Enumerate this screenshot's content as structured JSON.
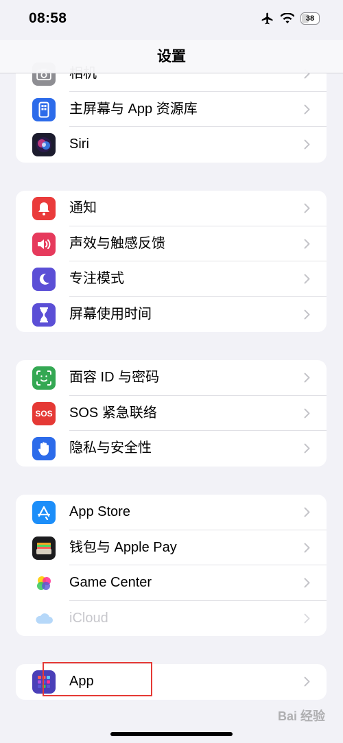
{
  "status_bar": {
    "time": "08:58",
    "battery": "38",
    "battery_fraction": 0.38
  },
  "nav": {
    "title": "设置"
  },
  "groups": [
    {
      "items": [
        {
          "label": "相机",
          "icon": "camera-icon",
          "color": "#8e8e93"
        },
        {
          "label": "主屏幕与 App 资源库",
          "icon": "home-screen-icon",
          "color": "#2c6bea"
        },
        {
          "label": "Siri",
          "icon": "siri-icon",
          "color": "#1c1c2e"
        }
      ]
    },
    {
      "items": [
        {
          "label": "通知",
          "icon": "bell-icon",
          "color": "#ea3b3b"
        },
        {
          "label": "声效与触感反馈",
          "icon": "speaker-icon",
          "color": "#e63a5c"
        },
        {
          "label": "专注模式",
          "icon": "moon-icon",
          "color": "#5b4fd6"
        },
        {
          "label": "屏幕使用时间",
          "icon": "hourglass-icon",
          "color": "#5b4fd6"
        }
      ]
    },
    {
      "items": [
        {
          "label": "面容 ID 与密码",
          "icon": "face-id-icon",
          "color": "#34a853"
        },
        {
          "label": "SOS 紧急联络",
          "icon": "sos-icon",
          "color": "#e53935",
          "icon_text": "SOS"
        },
        {
          "label": "隐私与安全性",
          "icon": "hand-icon",
          "color": "#2c6bea"
        }
      ]
    },
    {
      "items": [
        {
          "label": "App Store",
          "icon": "app-store-icon",
          "color": "#1c8ef9"
        },
        {
          "label": "钱包与 Apple Pay",
          "icon": "wallet-icon",
          "color": "#1c1c1e"
        },
        {
          "label": "Game Center",
          "icon": "game-center-icon",
          "color": "#ffffff"
        },
        {
          "label": "iCloud",
          "icon": "icloud-icon",
          "color": "#ffffff"
        }
      ]
    },
    {
      "items": [
        {
          "label": "App",
          "icon": "app-grid-icon",
          "color": "#4a3fb8"
        }
      ]
    }
  ],
  "watermark": "Bai 经验"
}
